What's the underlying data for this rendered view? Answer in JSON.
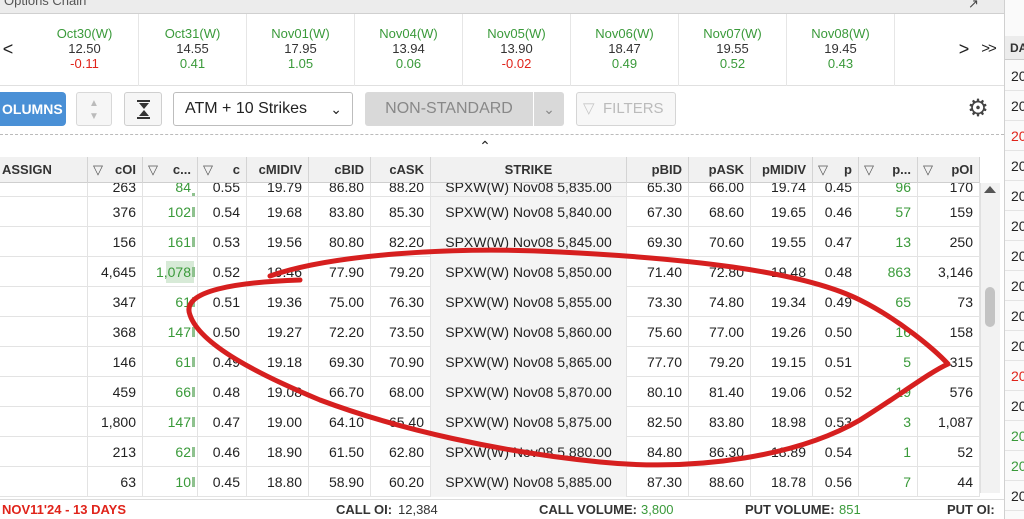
{
  "window": {
    "title": "Options Chain"
  },
  "expirations": [
    {
      "date": "Oct30(W)",
      "price": "12.50",
      "change": "-0.11",
      "dir": "neg"
    },
    {
      "date": "Oct31(W)",
      "price": "14.55",
      "change": "0.41",
      "dir": "pos"
    },
    {
      "date": "Nov01(W)",
      "price": "17.95",
      "change": "1.05",
      "dir": "pos"
    },
    {
      "date": "Nov04(W)",
      "price": "13.94",
      "change": "0.06",
      "dir": "pos"
    },
    {
      "date": "Nov05(W)",
      "price": "13.90",
      "change": "-0.02",
      "dir": "neg"
    },
    {
      "date": "Nov06(W)",
      "price": "18.47",
      "change": "0.49",
      "dir": "pos"
    },
    {
      "date": "Nov07(W)",
      "price": "19.55",
      "change": "0.52",
      "dir": "pos"
    },
    {
      "date": "Nov08(W)",
      "price": "19.45",
      "change": "0.43",
      "dir": "pos"
    }
  ],
  "nav": {
    "prev": "<",
    "next": ">",
    "last": ">>"
  },
  "toolbar": {
    "columns_label": "OLUMNS",
    "strike_filter": "ATM + 10 Strikes",
    "non_standard": "NON-STANDARD",
    "filters": "FILTERS"
  },
  "headers": {
    "assign": "ASSIGN",
    "coi": "cOI",
    "cvol": "c...",
    "c": "c",
    "cmidiv": "cMIDIV",
    "cbid": "cBID",
    "cask": "cASK",
    "strike": "STRIKE",
    "pbid": "pBID",
    "pask": "pASK",
    "pmidiv": "pMIDIV",
    "p": "p",
    "pvol": "p...",
    "poi": "pOI"
  },
  "rows": [
    {
      "coi": "263",
      "cvol": "84",
      "cdelta": "0.55",
      "cmidiv": "19.79",
      "cbid": "86.80",
      "cask": "88.20",
      "strike": "SPXW(W) Nov08 5,835.00",
      "pbid": "65.30",
      "pask": "66.00",
      "pmidiv": "19.74",
      "pdelta": "0.45",
      "pvol": "96",
      "poi": "170"
    },
    {
      "coi": "376",
      "cvol": "102",
      "cdelta": "0.54",
      "cmidiv": "19.68",
      "cbid": "83.80",
      "cask": "85.30",
      "strike": "SPXW(W) Nov08 5,840.00",
      "pbid": "67.30",
      "pask": "68.60",
      "pmidiv": "19.65",
      "pdelta": "0.46",
      "pvol": "57",
      "poi": "159"
    },
    {
      "coi": "156",
      "cvol": "161",
      "cdelta": "0.53",
      "cmidiv": "19.56",
      "cbid": "80.80",
      "cask": "82.20",
      "strike": "SPXW(W) Nov08 5,845.00",
      "pbid": "69.30",
      "pask": "70.60",
      "pmidiv": "19.55",
      "pdelta": "0.47",
      "pvol": "13",
      "poi": "250"
    },
    {
      "coi": "4,645",
      "cvol": "1,078",
      "cdelta": "0.52",
      "cmidiv": "19.46",
      "cbid": "77.90",
      "cask": "79.20",
      "strike": "SPXW(W) Nov08 5,850.00",
      "pbid": "71.40",
      "pask": "72.80",
      "pmidiv": "19.48",
      "pdelta": "0.48",
      "pvol": "863",
      "poi": "3,146"
    },
    {
      "coi": "347",
      "cvol": "61",
      "cdelta": "0.51",
      "cmidiv": "19.36",
      "cbid": "75.00",
      "cask": "76.30",
      "strike": "SPXW(W) Nov08 5,855.00",
      "pbid": "73.30",
      "pask": "74.80",
      "pmidiv": "19.34",
      "pdelta": "0.49",
      "pvol": "65",
      "poi": "73"
    },
    {
      "coi": "368",
      "cvol": "147",
      "cdelta": "0.50",
      "cmidiv": "19.27",
      "cbid": "72.20",
      "cask": "73.50",
      "strike": "SPXW(W) Nov08 5,860.00",
      "pbid": "75.60",
      "pask": "77.00",
      "pmidiv": "19.26",
      "pdelta": "0.50",
      "pvol": "16",
      "poi": "158"
    },
    {
      "coi": "146",
      "cvol": "61",
      "cdelta": "0.49",
      "cmidiv": "19.18",
      "cbid": "69.30",
      "cask": "70.90",
      "strike": "SPXW(W) Nov08 5,865.00",
      "pbid": "77.70",
      "pask": "79.20",
      "pmidiv": "19.15",
      "pdelta": "0.51",
      "pvol": "5",
      "poi": "315"
    },
    {
      "coi": "459",
      "cvol": "66",
      "cdelta": "0.48",
      "cmidiv": "19.08",
      "cbid": "66.70",
      "cask": "68.00",
      "strike": "SPXW(W) Nov08 5,870.00",
      "pbid": "80.10",
      "pask": "81.40",
      "pmidiv": "19.06",
      "pdelta": "0.52",
      "pvol": "19",
      "poi": "576"
    },
    {
      "coi": "1,800",
      "cvol": "147",
      "cdelta": "0.47",
      "cmidiv": "19.00",
      "cbid": "64.10",
      "cask": "65.40",
      "strike": "SPXW(W) Nov08 5,875.00",
      "pbid": "82.50",
      "pask": "83.80",
      "pmidiv": "18.98",
      "pdelta": "0.53",
      "pvol": "3",
      "poi": "1,087"
    },
    {
      "coi": "213",
      "cvol": "62",
      "cdelta": "0.46",
      "cmidiv": "18.90",
      "cbid": "61.50",
      "cask": "62.80",
      "strike": "SPXW(W) Nov08 5,880.00",
      "pbid": "84.80",
      "pask": "86.30",
      "pmidiv": "18.89",
      "pdelta": "0.54",
      "pvol": "1",
      "poi": "52"
    },
    {
      "coi": "63",
      "cvol": "10",
      "cdelta": "0.45",
      "cmidiv": "18.80",
      "cbid": "58.90",
      "cask": "60.20",
      "strike": "SPXW(W) Nov08 5,885.00",
      "pbid": "87.30",
      "pask": "88.60",
      "pmidiv": "18.78",
      "pdelta": "0.56",
      "pvol": "7",
      "poi": "44"
    }
  ],
  "footer": {
    "expiry": "NOV11'24 - 13 DAYS",
    "call_oi_label": "CALL OI:",
    "call_oi": "12,384",
    "call_volume_label": "CALL VOLUME:",
    "call_volume": "3,800",
    "put_volume_label": "PUT VOLUME:",
    "put_volume": "851",
    "put_oi_label": "PUT OI:"
  },
  "side_panel": {
    "header": "DA",
    "items": [
      {
        "text": "20",
        "color": "normal"
      },
      {
        "text": "20",
        "color": "normal"
      },
      {
        "text": "20",
        "color": "red"
      },
      {
        "text": "20",
        "color": "normal"
      },
      {
        "text": "20",
        "color": "normal"
      },
      {
        "text": "20",
        "color": "normal"
      },
      {
        "text": "20",
        "color": "normal"
      },
      {
        "text": "20",
        "color": "normal"
      },
      {
        "text": "20",
        "color": "normal"
      },
      {
        "text": "20",
        "color": "normal"
      },
      {
        "text": "20",
        "color": "red"
      },
      {
        "text": "20",
        "color": "normal"
      },
      {
        "text": "20",
        "color": "green"
      },
      {
        "text": "20",
        "color": "green"
      },
      {
        "text": "20",
        "color": "normal"
      }
    ]
  },
  "colors": {
    "accent": "#4a90d6",
    "positive": "#3a9a3a",
    "negative": "#e0241b",
    "annotation": "#d61f1f"
  }
}
